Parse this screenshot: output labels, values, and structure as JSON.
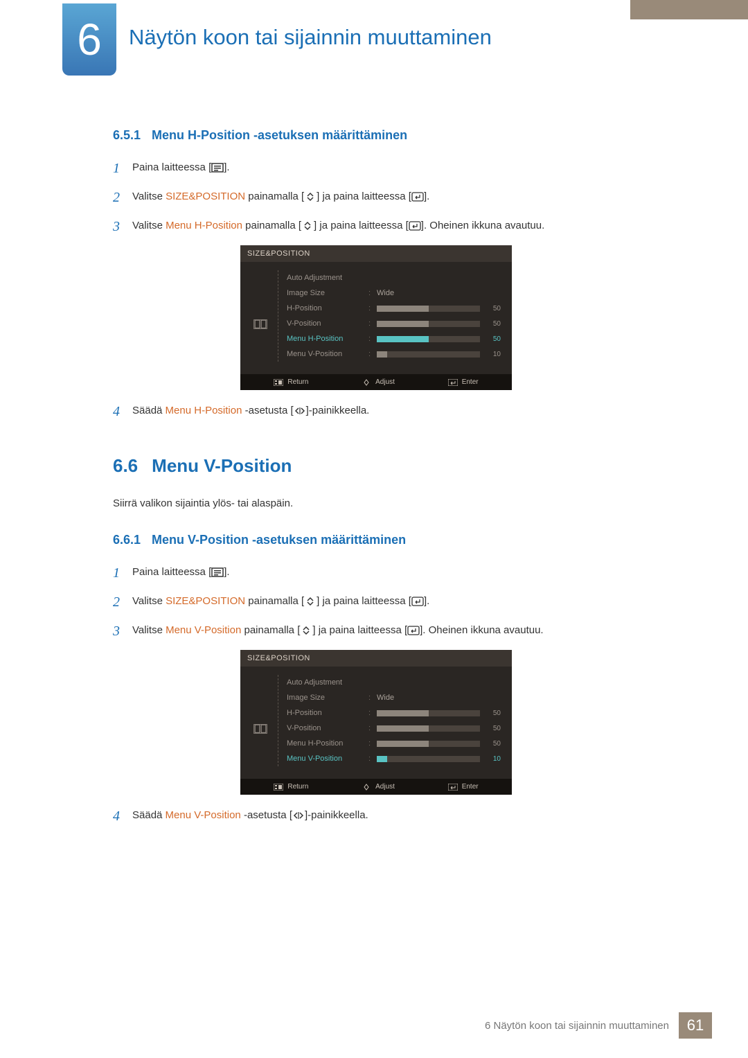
{
  "chapter": {
    "number": "6",
    "title": "Näytön koon tai sijainnin muuttaminen"
  },
  "section651": {
    "num": "6.5.1",
    "title": "Menu H-Position -asetuksen määrittäminen",
    "steps": {
      "s1": {
        "n": "1",
        "a": "Paina laitteessa [",
        "b": "]."
      },
      "s2": {
        "n": "2",
        "a": "Valitse ",
        "hl": "SIZE&POSITION",
        "b": " painamalla [",
        "c": "] ja paina laitteessa [",
        "d": "]."
      },
      "s3": {
        "n": "3",
        "a": "Valitse ",
        "hl": "Menu H-Position",
        "b": " painamalla [",
        "c": "] ja paina laitteessa [",
        "d": "]. Oheinen ikkuna avautuu."
      },
      "s4": {
        "n": "4",
        "a": "Säädä ",
        "hl": "Menu H-Position",
        "b": " -asetusta [",
        "c": "]-painikkeella."
      }
    }
  },
  "section66": {
    "num": "6.6",
    "title": "Menu V-Position",
    "lead": "Siirrä valikon sijaintia ylös- tai alaspäin."
  },
  "section661": {
    "num": "6.6.1",
    "title": "Menu V-Position -asetuksen määrittäminen",
    "steps": {
      "s1": {
        "n": "1",
        "a": "Paina laitteessa [",
        "b": "]."
      },
      "s2": {
        "n": "2",
        "a": "Valitse ",
        "hl": "SIZE&POSITION",
        "b": " painamalla [",
        "c": "] ja paina laitteessa [",
        "d": "]."
      },
      "s3": {
        "n": "3",
        "a": "Valitse ",
        "hl": "Menu V-Position",
        "b": " painamalla [",
        "c": "] ja paina laitteessa [",
        "d": "]. Oheinen ikkuna avautuu."
      },
      "s4": {
        "n": "4",
        "a": "Säädä ",
        "hl": "Menu V-Position",
        "b": " -asetusta [",
        "c": "]-painikkeella."
      }
    }
  },
  "osd1": {
    "header": "SIZE&POSITION",
    "rows": {
      "auto": {
        "label": "Auto Adjustment"
      },
      "size": {
        "label": "Image Size",
        "value": "Wide"
      },
      "hpos": {
        "label": "H-Position",
        "value": "50",
        "pct": 50
      },
      "vpos": {
        "label": "V-Position",
        "value": "50",
        "pct": 50
      },
      "mhpos": {
        "label": "Menu H-Position",
        "value": "50",
        "pct": 50,
        "active": true
      },
      "mvpos": {
        "label": "Menu V-Position",
        "value": "10",
        "pct": 10
      }
    },
    "footer": {
      "return": "Return",
      "adjust": "Adjust",
      "enter": "Enter"
    }
  },
  "osd2": {
    "header": "SIZE&POSITION",
    "rows": {
      "auto": {
        "label": "Auto Adjustment"
      },
      "size": {
        "label": "Image Size",
        "value": "Wide"
      },
      "hpos": {
        "label": "H-Position",
        "value": "50",
        "pct": 50
      },
      "vpos": {
        "label": "V-Position",
        "value": "50",
        "pct": 50
      },
      "mhpos": {
        "label": "Menu H-Position",
        "value": "50",
        "pct": 50
      },
      "mvpos": {
        "label": "Menu V-Position",
        "value": "10",
        "pct": 10,
        "active": true
      }
    },
    "footer": {
      "return": "Return",
      "adjust": "Adjust",
      "enter": "Enter"
    }
  },
  "pageFooter": {
    "text": "6 Näytön koon tai sijainnin muuttaminen",
    "page": "61"
  }
}
